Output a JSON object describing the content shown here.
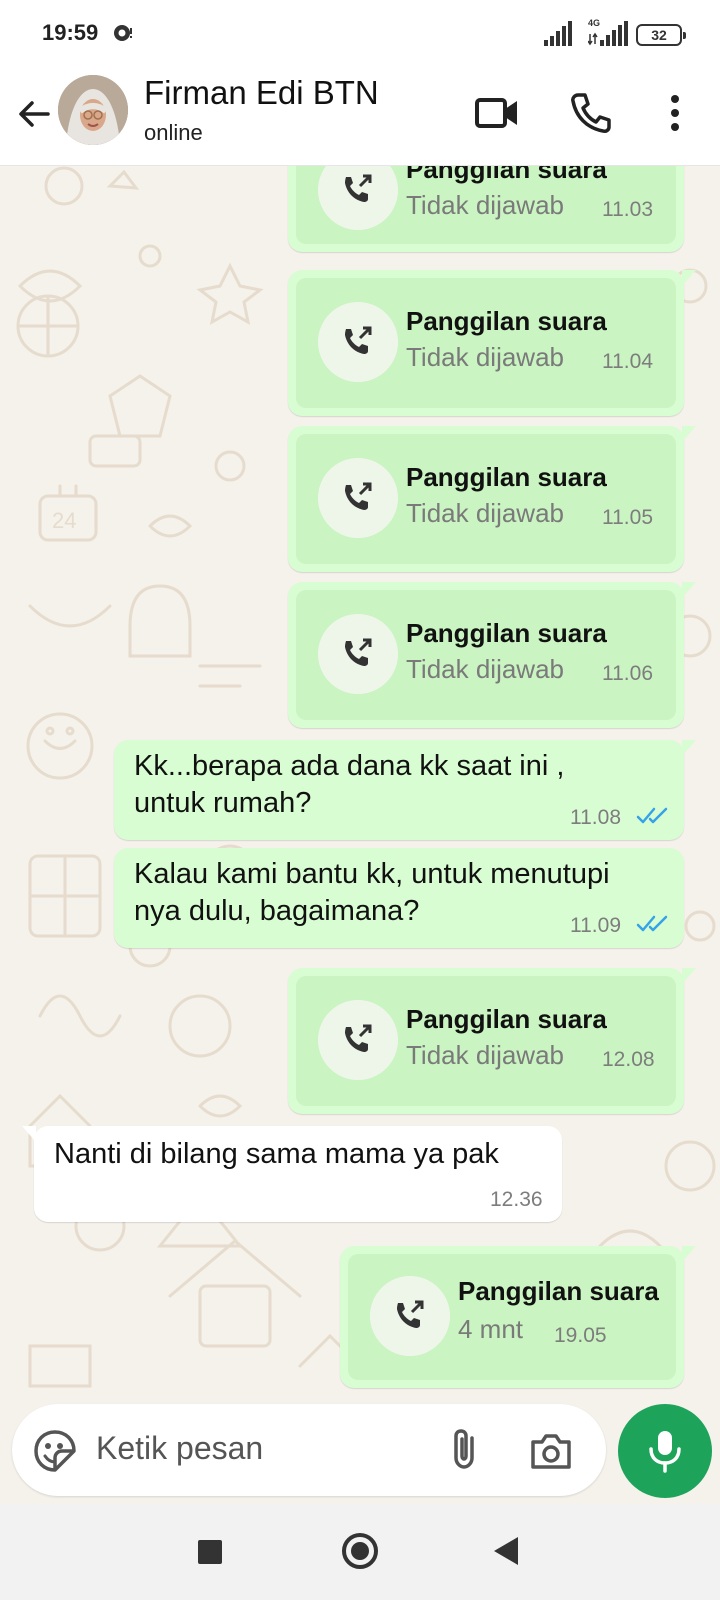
{
  "status_bar": {
    "time": "19:59",
    "network": "4G",
    "battery": "32"
  },
  "header": {
    "contact_name": "Firman Edi BTN",
    "contact_status": "online"
  },
  "messages": [
    {
      "type": "call",
      "title": "Panggilan suara",
      "sub": "Tidak dijawab",
      "time": "11.03"
    },
    {
      "type": "call",
      "title": "Panggilan suara",
      "sub": "Tidak dijawab",
      "time": "11.04"
    },
    {
      "type": "call",
      "title": "Panggilan suara",
      "sub": "Tidak dijawab",
      "time": "11.05"
    },
    {
      "type": "call",
      "title": "Panggilan suara",
      "sub": "Tidak dijawab",
      "time": "11.06"
    },
    {
      "type": "text",
      "line1": "Kk...berapa ada dana kk saat ini ,",
      "line2": "untuk rumah?",
      "time": "11.08"
    },
    {
      "type": "text",
      "line1": "Kalau kami bantu kk, untuk menutupi",
      "line2": "nya dulu, bagaimana?",
      "time": "11.09"
    },
    {
      "type": "call",
      "title": "Panggilan suara",
      "sub": "Tidak dijawab",
      "time": "12.08"
    },
    {
      "type": "text_in",
      "text": "Nanti di bilang sama mama ya pak",
      "time": "12.36"
    },
    {
      "type": "call",
      "title": "Panggilan suara",
      "sub": "4 mnt",
      "time": "19.05"
    }
  ],
  "input": {
    "placeholder": "Ketik pesan"
  },
  "colors": {
    "outgoing_bubble": "#d9fdd3",
    "accent": "#1ea35a",
    "read_ticks": "#34a3e8",
    "chat_bg": "#f5f1eb"
  }
}
